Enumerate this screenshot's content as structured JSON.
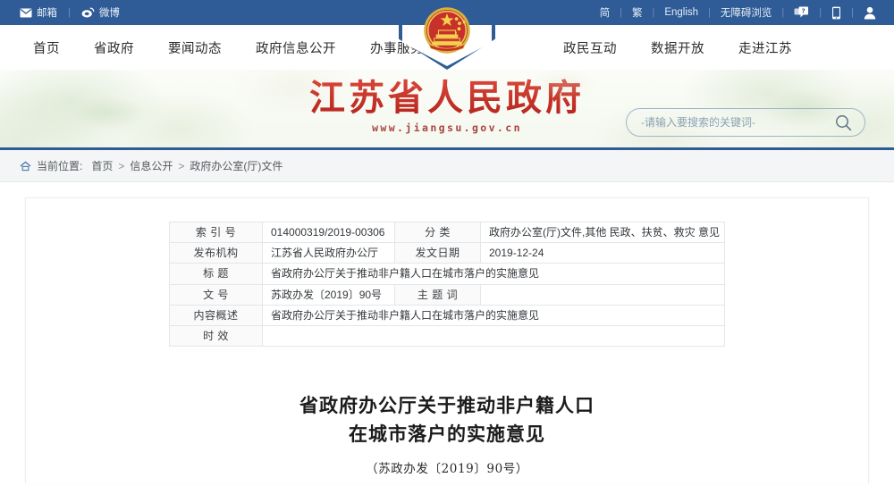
{
  "topbar": {
    "left_links": [
      {
        "label": "邮箱",
        "icon": "mail-icon"
      },
      {
        "label": "微博",
        "icon": "weibo-icon"
      }
    ],
    "right_links": [
      {
        "label": "简"
      },
      {
        "label": "繁"
      },
      {
        "label": "English"
      },
      {
        "label": "无障碍浏览"
      }
    ],
    "right_icons": [
      {
        "name": "help-chat-icon"
      },
      {
        "name": "mobile-icon"
      },
      {
        "name": "user-icon"
      }
    ],
    "separator": "|"
  },
  "nav": {
    "left_items": [
      {
        "label": "首页"
      },
      {
        "label": "省政府"
      },
      {
        "label": "要闻动态"
      },
      {
        "label": "政府信息公开"
      },
      {
        "label": "办事服务"
      }
    ],
    "right_items": [
      {
        "label": "政民互动"
      },
      {
        "label": "数据开放"
      },
      {
        "label": "走进江苏"
      }
    ],
    "emblem_alt": "national-emblem"
  },
  "banner": {
    "site_title": "江苏省人民政府",
    "site_url": "www.jiangsu.gov.cn",
    "title_color": "#c0392b"
  },
  "search": {
    "placeholder": "-请输入要搜索的关键词-",
    "value": "",
    "button_icon": "search-icon"
  },
  "breadcrumb": {
    "home_icon": "home-icon",
    "prefix": "当前位置:",
    "items": [
      {
        "label": "首页"
      },
      {
        "label": "信息公开"
      },
      {
        "label": "政府办公室(厅)文件"
      }
    ],
    "separator": ">"
  },
  "meta_table": {
    "rows": [
      {
        "label1": "索 引 号",
        "value1": "014000319/2019-00306",
        "label2": "分      类",
        "value2": "政府办公室(厅)文件,其他 民政、扶贫、救灾 意见"
      },
      {
        "label1": "发布机构",
        "value1": "江苏省人民政府办公厅",
        "label2": "发文日期",
        "value2": "2019-12-24"
      },
      {
        "label1": "标      题",
        "value1": "省政府办公厅关于推动非户籍人口在城市落户的实施意见"
      },
      {
        "label1": "文      号",
        "value1": "苏政办发〔2019〕90号",
        "label2": "主 题 词",
        "value2": ""
      },
      {
        "label1": "内容概述",
        "value1": "省政府办公厅关于推动非户籍人口在城市落户的实施意见"
      },
      {
        "label1": "时      效",
        "value1": ""
      }
    ]
  },
  "document": {
    "title_line1": "省政府办公厅关于推动非户籍人口",
    "title_line2": "在城市落户的实施意见",
    "subtitle": "（苏政办发〔2019〕90号）"
  },
  "colors": {
    "header_blue": "#2f5c96",
    "title_red": "#c0392b",
    "crumb_bg": "#f4f5f6"
  }
}
